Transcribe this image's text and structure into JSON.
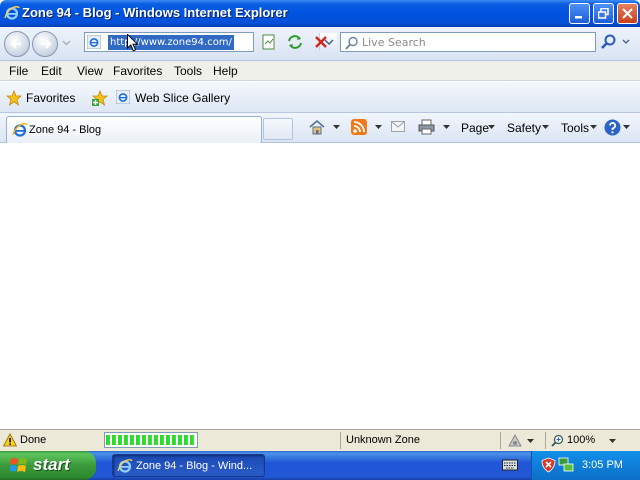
{
  "window": {
    "title": "Zone 94 - Blog - Windows Internet Explorer"
  },
  "navbar": {
    "address": "http://www.zone94.com/",
    "search_placeholder": "Live Search"
  },
  "menu": [
    "File",
    "Edit",
    "View",
    "Favorites",
    "Tools",
    "Help"
  ],
  "favorites_bar": {
    "favorites_label": "Favorites",
    "web_slice_label": "Web Slice Gallery"
  },
  "tabs": [
    {
      "label": "Zone 94 - Blog",
      "active": true
    }
  ],
  "command_bar": {
    "page_label": "Page",
    "safety_label": "Safety",
    "tools_label": "Tools"
  },
  "status": {
    "text": "Done",
    "progress": 1.0,
    "zone": "Unknown Zone",
    "zoom": "100%"
  },
  "taskbar": {
    "start_label": "start",
    "task_label": "Zone 94 - Blog - Wind...",
    "clock": "3:05 PM"
  },
  "colors": {
    "titlebar": "#0053e0",
    "selection": "#316ac5",
    "start_green": "#3a9a3a",
    "taskbar_blue": "#2157d7"
  }
}
